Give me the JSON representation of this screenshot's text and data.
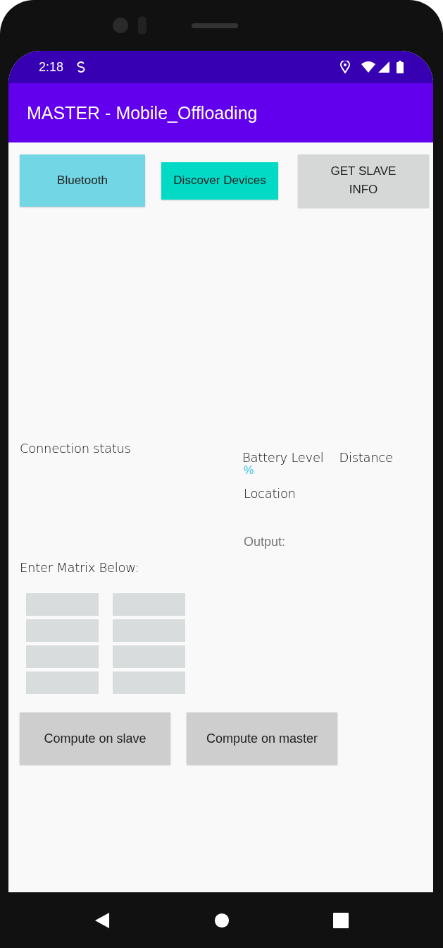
{
  "status_bar": {
    "time": "2:18"
  },
  "app_bar": {
    "title": "MASTER - Mobile_Offloading"
  },
  "top_buttons": [
    {
      "label": "Bluetooth",
      "kind": "bluetooth"
    },
    {
      "label": "Discover Devices",
      "kind": "discover"
    },
    {
      "label": "GET SLAVE INFO",
      "kind": "plain"
    }
  ],
  "connection_status": "Connection status",
  "slave_info": {
    "battery_label": "Battery Level",
    "distance_label": "Distance",
    "battery_unit": "%",
    "location_label": "Location",
    "output_label": "Output:"
  },
  "matrix": {
    "label": "Enter Matrix Below:",
    "columns": [
      {
        "cells": [
          {
            "kind": "field"
          },
          {
            "kind": "field"
          },
          {
            "kind": "field"
          },
          {
            "kind": "field"
          }
        ]
      },
      {
        "cells": [
          {
            "kind": "field"
          },
          {
            "kind": "field"
          },
          {
            "kind": "field"
          },
          {
            "kind": "field"
          }
        ]
      }
    ]
  },
  "compute_buttons": [
    {
      "label": "Compute on slave"
    },
    {
      "label": "Compute on master"
    }
  ]
}
